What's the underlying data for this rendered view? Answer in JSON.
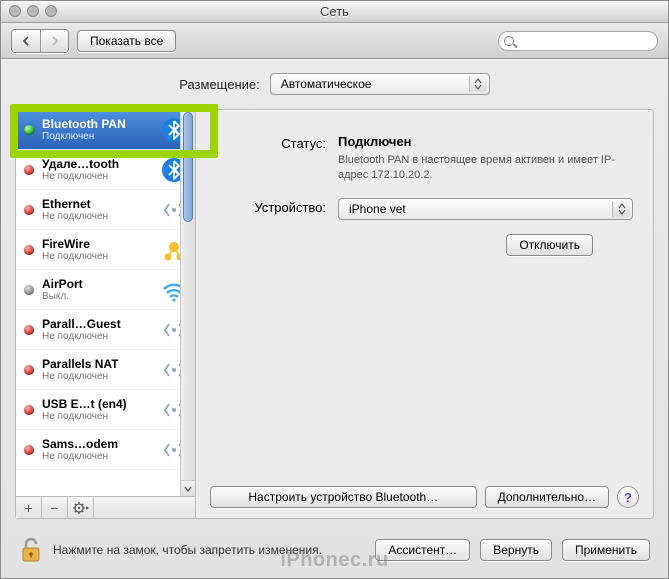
{
  "window": {
    "title": "Сеть"
  },
  "toolbar": {
    "show_all": "Показать все",
    "search_placeholder": ""
  },
  "location": {
    "label": "Размещение:",
    "value": "Автоматическое"
  },
  "sidebar": {
    "items": [
      {
        "name": "Bluetooth PAN",
        "sub": "Подключен",
        "status": "green",
        "icon": "bluetooth",
        "selected": true
      },
      {
        "name": "Удале…tooth",
        "sub": "Не подключен",
        "status": "red",
        "icon": "bluetooth"
      },
      {
        "name": "Ethernet",
        "sub": "Не подключен",
        "status": "red",
        "icon": "ethernet"
      },
      {
        "name": "FireWire",
        "sub": "Не подключен",
        "status": "red",
        "icon": "firewire"
      },
      {
        "name": "AirPort",
        "sub": "Выкл.",
        "status": "gray",
        "icon": "wifi"
      },
      {
        "name": "Parall…Guest",
        "sub": "Не подключен",
        "status": "red",
        "icon": "ethernet"
      },
      {
        "name": "Parallels NAT",
        "sub": "Не подключен",
        "status": "red",
        "icon": "ethernet"
      },
      {
        "name": "USB E…t (en4)",
        "sub": "Не подключен",
        "status": "red",
        "icon": "ethernet"
      },
      {
        "name": "Sams…odem",
        "sub": "Не подключен",
        "status": "red",
        "icon": "ethernet"
      }
    ]
  },
  "detail": {
    "status_label": "Статус:",
    "status_value": "Подключен",
    "status_desc": "Bluetooth PAN в настоящее время активен и имеет IP-адрес 172.10.20.2.",
    "device_label": "Устройство:",
    "device_value": "iPhone vet",
    "disconnect": "Отключить",
    "configure_bt": "Настроить устройство Bluetooth…",
    "advanced": "Дополнительно…"
  },
  "footer": {
    "lock_text": "Нажмите на замок, чтобы запретить изменения.",
    "assist": "Ассистент…",
    "revert": "Вернуть",
    "apply": "Применить"
  },
  "watermark": "iPhonec.ru"
}
